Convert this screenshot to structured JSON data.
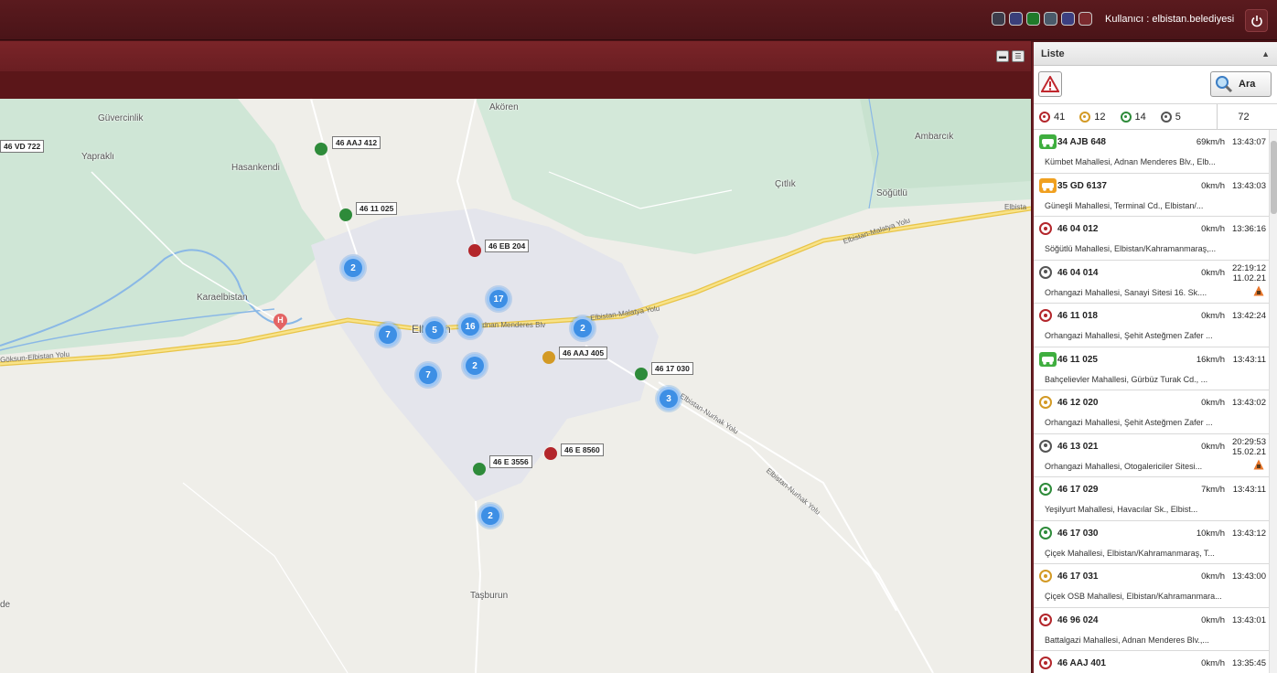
{
  "header": {
    "user_label": "Kullanıcı : elbistan.belediyesi",
    "theme_colors": [
      "#3c3c4a",
      "#3a3f7a",
      "#1f7a2a",
      "#4a5a6a",
      "#3b3f80",
      "#7a2a2e"
    ]
  },
  "panel": {
    "title": "Liste",
    "collapse_icon": "chevron-up-icon",
    "search_label": "Ara",
    "summary": {
      "red": "41",
      "orange": "12",
      "green": "14",
      "gray": "5",
      "total": "72"
    },
    "vehicles": [
      {
        "plate": "34 AJB 648",
        "speed": "69km/h",
        "time": "13:43:07",
        "date": "",
        "address": "Kümbet Mahallesi, Adnan Menderes Blv., Elb...",
        "icon": "car-green"
      },
      {
        "plate": "35 GD 6137",
        "speed": "0km/h",
        "time": "13:43:03",
        "date": "",
        "address": "Güneşli Mahallesi, Terminal Cd., Elbistan/...",
        "icon": "car-orange"
      },
      {
        "plate": "46 04 012",
        "speed": "0km/h",
        "time": "13:36:16",
        "date": "",
        "address": "Söğütlü Mahallesi, Elbistan/Kahramanmaraş,...",
        "icon": "red"
      },
      {
        "plate": "46 04 014",
        "speed": "0km/h",
        "time": "22:19:12",
        "date": "11.02.21",
        "address": "Orhangazi Mahallesi, Sanayi Sitesi 16. Sk....",
        "icon": "gray",
        "warn": true
      },
      {
        "plate": "46 11 018",
        "speed": "0km/h",
        "time": "13:42:24",
        "date": "",
        "address": "Orhangazi Mahallesi, Şehit Asteğmen Zafer ...",
        "icon": "red"
      },
      {
        "plate": "46 11 025",
        "speed": "16km/h",
        "time": "13:43:11",
        "date": "",
        "address": "Bahçelievler Mahallesi, Gürbüz Turak Cd., ...",
        "icon": "car-green"
      },
      {
        "plate": "46 12 020",
        "speed": "0km/h",
        "time": "13:43:02",
        "date": "",
        "address": "Orhangazi Mahallesi, Şehit Asteğmen Zafer ...",
        "icon": "orange"
      },
      {
        "plate": "46 13 021",
        "speed": "0km/h",
        "time": "20:29:53",
        "date": "15.02.21",
        "address": "Orhangazi Mahallesi, Otogalericiler Sitesi...",
        "icon": "gray",
        "warn": true
      },
      {
        "plate": "46 17 029",
        "speed": "7km/h",
        "time": "13:43:11",
        "date": "",
        "address": "Yeşilyurt Mahallesi, Havacılar Sk., Elbist...",
        "icon": "green"
      },
      {
        "plate": "46 17 030",
        "speed": "10km/h",
        "time": "13:43:12",
        "date": "",
        "address": "Çiçek Mahallesi, Elbistan/Kahramanmaraş, T...",
        "icon": "green"
      },
      {
        "plate": "46 17 031",
        "speed": "0km/h",
        "time": "13:43:00",
        "date": "",
        "address": "Çiçek OSB Mahallesi, Elbistan/Kahramanmara...",
        "icon": "orange"
      },
      {
        "plate": "46 96 024",
        "speed": "0km/h",
        "time": "13:43:01",
        "date": "",
        "address": "Battalgazi Mahallesi, Adnan Menderes Blv.,...",
        "icon": "red"
      },
      {
        "plate": "46 AAJ 401",
        "speed": "0km/h",
        "time": "13:35:45",
        "date": "",
        "address": "",
        "icon": "red"
      }
    ]
  },
  "map": {
    "places": [
      "Güvercinlik",
      "Yapraklı",
      "Hasankendi",
      "Karaelbistan",
      "Akören",
      "Çıtlık",
      "Ambarcık",
      "Söğütlü",
      "Taşburun",
      "Elbistan",
      "de"
    ],
    "roads": [
      "Elbistan-Malatya Yolu",
      "Elbistan-Malatya Yolu",
      "Göksun-Elbistan Yolu",
      "Adnan Menderes Blv",
      "Elbista",
      "Elbistan-Nurhak Yolu",
      "Elbistan-Nurhak Yolu"
    ],
    "clusters": [
      "2",
      "17",
      "7",
      "5",
      "16",
      "2",
      "7",
      "2",
      "3",
      "2"
    ],
    "vehicle_tags": [
      "46 VD 722",
      "46 AAJ 412",
      "46 11 025",
      "46 EB 204",
      "46 AAJ 405",
      "46 17 030",
      "46 E 8560",
      "46 E 3556"
    ]
  }
}
